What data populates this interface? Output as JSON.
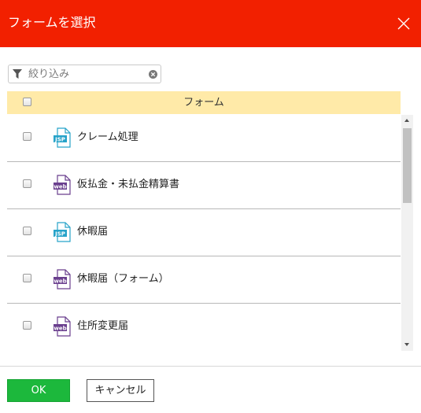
{
  "dialog": {
    "title": "フォームを選択"
  },
  "filter": {
    "placeholder": "絞り込み"
  },
  "table": {
    "column_header": "フォーム"
  },
  "rows": [
    {
      "label": "クレーム処理",
      "icon": "jsp-file-icon"
    },
    {
      "label": "仮払金・未払金精算書",
      "icon": "web-file-icon"
    },
    {
      "label": "休暇届",
      "icon": "jsp-file-icon"
    },
    {
      "label": "休暇届（フォーム）",
      "icon": "web-file-icon"
    },
    {
      "label": "住所変更届",
      "icon": "web-file-icon"
    }
  ],
  "buttons": {
    "ok": "OK",
    "cancel": "キャンセル"
  },
  "icon_text": {
    "jsp": "JSP",
    "web": "web"
  },
  "colors": {
    "header": "#f22000",
    "table_header": "#ffeaa8",
    "ok_button": "#1cb83c",
    "jsp_icon": "#27a3c9",
    "web_icon": "#6a3f8e"
  }
}
